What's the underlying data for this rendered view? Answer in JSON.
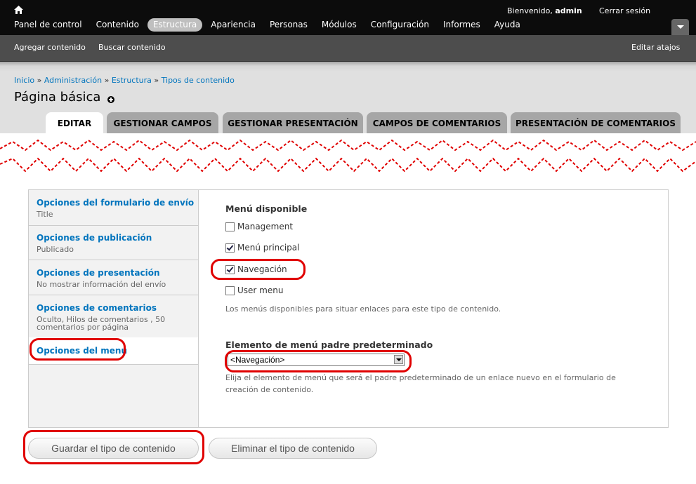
{
  "toolbar": {
    "welcome_prefix": "Bienvenido,",
    "username": "admin",
    "logout": "Cerrar sesión",
    "menu": [
      "Panel de control",
      "Contenido",
      "Estructura",
      "Apariencia",
      "Personas",
      "Módulos",
      "Configuración",
      "Informes",
      "Ayuda"
    ],
    "active_menu": "Estructura"
  },
  "shortcuts": {
    "items": [
      "Agregar contenido",
      "Buscar contenido"
    ],
    "edit": "Editar atajos"
  },
  "breadcrumb": [
    "Inicio",
    "Administración",
    "Estructura",
    "Tipos de contenido"
  ],
  "page_title": "Página básica",
  "tabs": [
    "EDITAR",
    "GESTIONAR CAMPOS",
    "GESTIONAR PRESENTACIÓN",
    "CAMPOS DE COMENTARIOS",
    "PRESENTACIÓN DE COMENTARIOS"
  ],
  "vertical_tabs": [
    {
      "title": "Opciones del formulario de envío",
      "summary": "Title"
    },
    {
      "title": "Opciones de publicación",
      "summary": "Publicado"
    },
    {
      "title": "Opciones de presentación",
      "summary": "No mostrar información del envío"
    },
    {
      "title": "Opciones de comentarios",
      "summary": "Oculto, Hilos de comentarios , 50 comentarios por página"
    },
    {
      "title": "Opciones del menú",
      "summary": ""
    }
  ],
  "menu_pane": {
    "available_label": "Menú disponible",
    "menus": [
      {
        "label": "Management",
        "checked": false
      },
      {
        "label": "Menú principal",
        "checked": true
      },
      {
        "label": "Navegación",
        "checked": true
      },
      {
        "label": "User menu",
        "checked": false
      }
    ],
    "available_desc": "Los menús disponibles para situar enlaces para este tipo de contenido.",
    "parent_label": "Elemento de menú padre predeterminado",
    "parent_value": "<Navegación>",
    "parent_desc": "Elija el elemento de menú que será el padre predeterminado de un enlace nuevo en el formulario de creación de contenido."
  },
  "buttons": {
    "save": "Guardar el tipo de contenido",
    "delete": "Eliminar el tipo de contenido"
  },
  "colors": {
    "link": "#0074bd",
    "annotation": "#e00000",
    "toolbar": "#0c0c0c"
  }
}
